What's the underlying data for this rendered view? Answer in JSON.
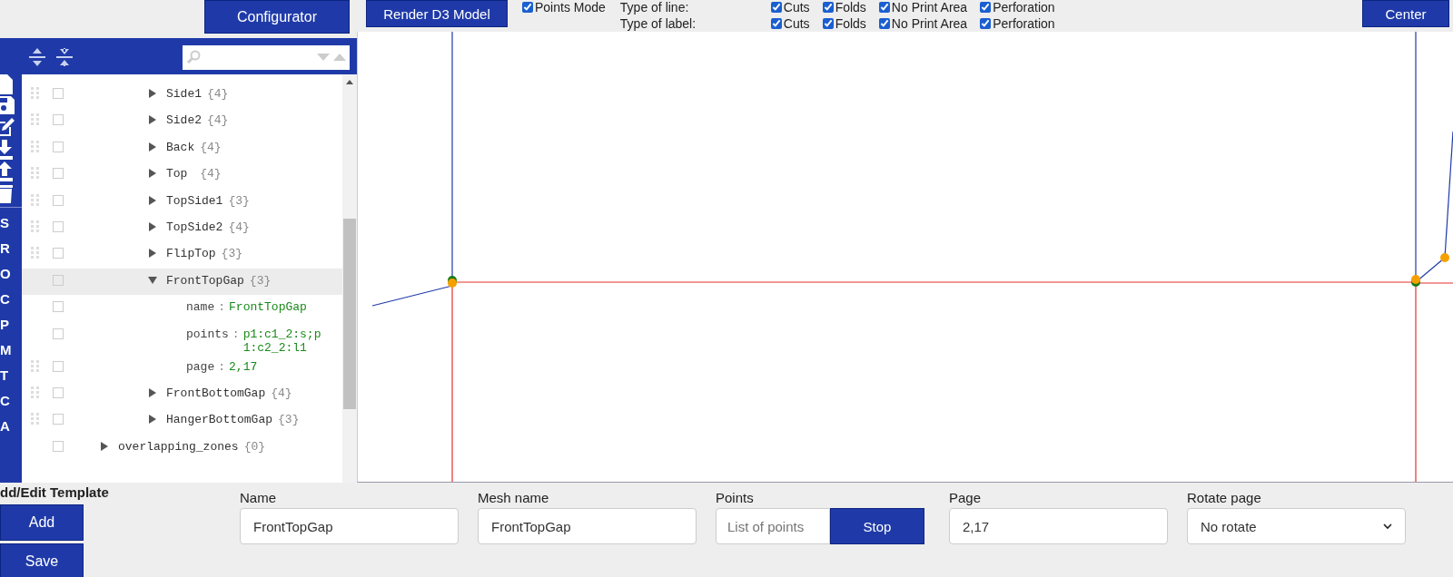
{
  "configurator_button": "Configurator",
  "toolbar": {
    "render_button": "Render D3 Model",
    "points_mode": {
      "label": "Points Mode",
      "checked": true
    },
    "line_types": {
      "label": "Type of line:",
      "options": [
        {
          "label": "Cuts",
          "checked": true
        },
        {
          "label": "Folds",
          "checked": true
        },
        {
          "label": "No Print Area",
          "checked": true
        },
        {
          "label": "Perforation",
          "checked": true
        }
      ]
    },
    "label_types": {
      "label": "Type of label:",
      "options": [
        {
          "label": "Cuts",
          "checked": true
        },
        {
          "label": "Folds",
          "checked": true
        },
        {
          "label": "No Print Area",
          "checked": true
        },
        {
          "label": "Perforation",
          "checked": true
        }
      ]
    },
    "center_button": "Center"
  },
  "side_strip": {
    "letters": [
      "S",
      "R",
      "O",
      "C",
      "P",
      "M",
      "T",
      "C",
      "A"
    ]
  },
  "tree": {
    "items": [
      {
        "children": [
          {
            "kind": "node",
            "label": "Side1",
            "count": "{4}",
            "expanded": false,
            "selected": false,
            "draggable": true
          },
          {
            "kind": "node",
            "label": "Side2",
            "count": "{4}",
            "expanded": false,
            "selected": false,
            "draggable": true
          },
          {
            "kind": "node",
            "label": "Back",
            "count": "{4}",
            "expanded": false,
            "selected": false,
            "draggable": true
          },
          {
            "kind": "node",
            "label": "Top ",
            "count": "{4}",
            "expanded": false,
            "selected": false,
            "draggable": true
          },
          {
            "kind": "node",
            "label": "TopSide1",
            "count": "{3}",
            "expanded": false,
            "selected": false,
            "draggable": true
          },
          {
            "kind": "node",
            "label": "TopSide2",
            "count": "{4}",
            "expanded": false,
            "selected": false,
            "draggable": true
          },
          {
            "kind": "node",
            "label": "FlipTop",
            "count": "{3}",
            "expanded": false,
            "selected": false,
            "draggable": true
          },
          {
            "kind": "node",
            "label": "FrontTopGap",
            "count": "{3}",
            "expanded": true,
            "selected": true,
            "draggable": false,
            "children": [
              {
                "kind": "property",
                "key": "name",
                "separator": ":",
                "value": "FrontTopGap",
                "draggable": false
              },
              {
                "kind": "property",
                "key": "points",
                "separator": ":",
                "value": "p1:c1_2:s;p1:c2_2:l1",
                "draggable": false
              },
              {
                "kind": "property",
                "key": "page",
                "separator": ":",
                "value": "2,17",
                "draggable": true
              }
            ]
          },
          {
            "kind": "node",
            "label": "FrontBottomGap",
            "count": "{4}",
            "expanded": false,
            "selected": false,
            "draggable": true
          },
          {
            "kind": "node",
            "label": "HangerBottomGap",
            "count": "{3}",
            "expanded": false,
            "selected": false,
            "draggable": true
          }
        ]
      },
      {
        "kind": "node",
        "label": "overlapping_zones",
        "count": "{0}",
        "expanded": false,
        "selected": false,
        "draggable": false
      }
    ]
  },
  "form": {
    "title": "dd/Edit Template",
    "add_button": "Add",
    "save_button": "Save",
    "fields": [
      {
        "kind": "text",
        "label": "Name",
        "value": "FrontTopGap"
      },
      {
        "kind": "text",
        "label": "Mesh name",
        "value": "FrontTopGap"
      },
      {
        "kind": "points",
        "label": "Points",
        "placeholder": "List of points",
        "button": "Stop"
      },
      {
        "kind": "text",
        "label": "Page",
        "value": "2,17"
      },
      {
        "kind": "select",
        "label": "Rotate page",
        "value": "No rotate"
      }
    ]
  }
}
